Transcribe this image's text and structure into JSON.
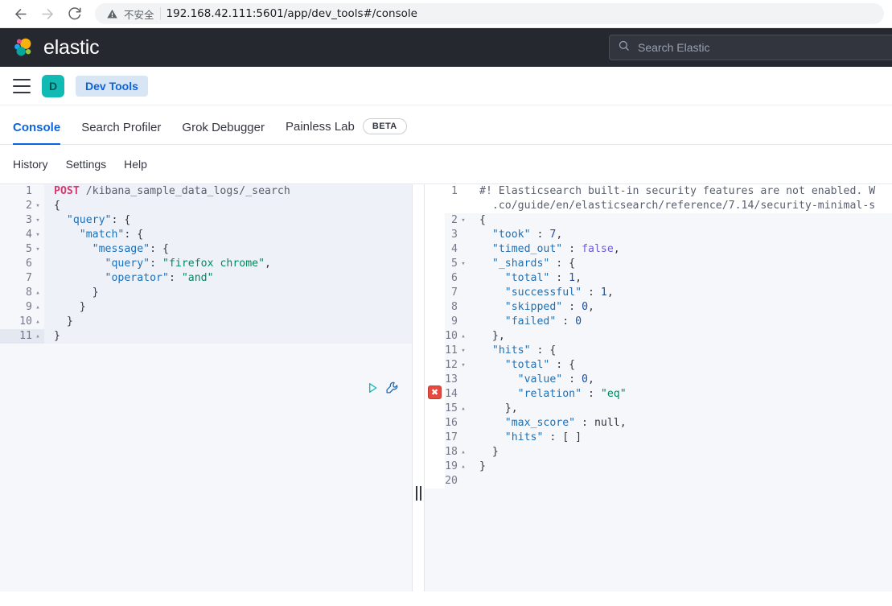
{
  "browser": {
    "back_icon": "back-arrow-icon",
    "forward_icon": "forward-arrow-icon",
    "reload_icon": "reload-icon",
    "warning_icon": "warning-triangle-icon",
    "insecure_label": "不安全",
    "url": "192.168.42.111:5601/app/dev_tools#/console"
  },
  "header": {
    "brand": "elastic",
    "logo_icon": "elastic-logo-icon",
    "search": {
      "icon": "search-icon",
      "placeholder": "Search Elastic",
      "value": ""
    }
  },
  "breadcrumb": {
    "menu_icon": "hamburger-menu-icon",
    "avatar_initial": "D",
    "app_name": "Dev Tools"
  },
  "tabs": [
    {
      "label": "Console",
      "active": true,
      "badge": ""
    },
    {
      "label": "Search Profiler",
      "active": false,
      "badge": ""
    },
    {
      "label": "Grok Debugger",
      "active": false,
      "badge": ""
    },
    {
      "label": "Painless Lab",
      "active": false,
      "badge": "BETA"
    }
  ],
  "submenu": [
    {
      "label": "History"
    },
    {
      "label": "Settings"
    },
    {
      "label": "Help"
    }
  ],
  "console": {
    "play_icon": "play-triangle-icon",
    "wrench_icon": "wrench-icon",
    "splitter_icon": "pane-resize-handle-icon",
    "error_icon": "error-x-icon",
    "request": {
      "lines": [
        {
          "n": "1",
          "fold": "",
          "active": false,
          "tokens": [
            {
              "c": "t-method",
              "t": "POST"
            },
            {
              "c": "t-path",
              "t": " /kibana_sample_data_logs/_search"
            }
          ]
        },
        {
          "n": "2",
          "fold": "▾",
          "active": false,
          "tokens": [
            {
              "c": "t-punct",
              "t": "{"
            }
          ]
        },
        {
          "n": "3",
          "fold": "▾",
          "active": false,
          "tokens": [
            {
              "c": "t-punct",
              "t": "  "
            },
            {
              "c": "t-key",
              "t": "\"query\""
            },
            {
              "c": "t-punct",
              "t": ": {"
            }
          ]
        },
        {
          "n": "4",
          "fold": "▾",
          "active": false,
          "tokens": [
            {
              "c": "t-punct",
              "t": "    "
            },
            {
              "c": "t-key",
              "t": "\"match\""
            },
            {
              "c": "t-punct",
              "t": ": {"
            }
          ]
        },
        {
          "n": "5",
          "fold": "▾",
          "active": false,
          "tokens": [
            {
              "c": "t-punct",
              "t": "      "
            },
            {
              "c": "t-key",
              "t": "\"message\""
            },
            {
              "c": "t-punct",
              "t": ": {"
            }
          ]
        },
        {
          "n": "6",
          "fold": "",
          "active": false,
          "tokens": [
            {
              "c": "t-punct",
              "t": "        "
            },
            {
              "c": "t-key",
              "t": "\"query\""
            },
            {
              "c": "t-punct",
              "t": ": "
            },
            {
              "c": "t-string",
              "t": "\"firefox chrome\""
            },
            {
              "c": "t-punct",
              "t": ","
            }
          ]
        },
        {
          "n": "7",
          "fold": "",
          "active": false,
          "tokens": [
            {
              "c": "t-punct",
              "t": "        "
            },
            {
              "c": "t-key",
              "t": "\"operator\""
            },
            {
              "c": "t-punct",
              "t": ": "
            },
            {
              "c": "t-string",
              "t": "\"and\""
            }
          ]
        },
        {
          "n": "8",
          "fold": "▴",
          "active": false,
          "tokens": [
            {
              "c": "t-punct",
              "t": "      }"
            }
          ]
        },
        {
          "n": "9",
          "fold": "▴",
          "active": false,
          "tokens": [
            {
              "c": "t-punct",
              "t": "    }"
            }
          ]
        },
        {
          "n": "10",
          "fold": "▴",
          "active": false,
          "tokens": [
            {
              "c": "t-punct",
              "t": "  }"
            }
          ]
        },
        {
          "n": "11",
          "fold": "▴",
          "active": true,
          "tokens": [
            {
              "c": "t-punct",
              "t": "}"
            }
          ]
        }
      ]
    },
    "response": {
      "lines": [
        {
          "n": "1",
          "fold": "",
          "active": true,
          "tokens": [
            {
              "c": "t-comment",
              "t": "#! Elasticsearch built-in security features are not enabled. W"
            }
          ]
        },
        {
          "n": "",
          "fold": "",
          "active": true,
          "tokens": [
            {
              "c": "t-comment",
              "t": "  .co/guide/en/elasticsearch/reference/7.14/security-minimal-s"
            }
          ]
        },
        {
          "n": "2",
          "fold": "▾",
          "active": false,
          "tokens": [
            {
              "c": "t-punct",
              "t": "{"
            }
          ]
        },
        {
          "n": "3",
          "fold": "",
          "active": false,
          "tokens": [
            {
              "c": "t-punct",
              "t": "  "
            },
            {
              "c": "t-key",
              "t": "\"took\""
            },
            {
              "c": "t-punct",
              "t": " : "
            },
            {
              "c": "t-number",
              "t": "7"
            },
            {
              "c": "t-punct",
              "t": ","
            }
          ]
        },
        {
          "n": "4",
          "fold": "",
          "active": false,
          "tokens": [
            {
              "c": "t-punct",
              "t": "  "
            },
            {
              "c": "t-key",
              "t": "\"timed_out\""
            },
            {
              "c": "t-punct",
              "t": " : "
            },
            {
              "c": "t-bool",
              "t": "false"
            },
            {
              "c": "t-punct",
              "t": ","
            }
          ]
        },
        {
          "n": "5",
          "fold": "▾",
          "active": false,
          "tokens": [
            {
              "c": "t-punct",
              "t": "  "
            },
            {
              "c": "t-key",
              "t": "\"_shards\""
            },
            {
              "c": "t-punct",
              "t": " : {"
            }
          ]
        },
        {
          "n": "6",
          "fold": "",
          "active": false,
          "tokens": [
            {
              "c": "t-punct",
              "t": "    "
            },
            {
              "c": "t-key",
              "t": "\"total\""
            },
            {
              "c": "t-punct",
              "t": " : "
            },
            {
              "c": "t-number",
              "t": "1"
            },
            {
              "c": "t-punct",
              "t": ","
            }
          ]
        },
        {
          "n": "7",
          "fold": "",
          "active": false,
          "tokens": [
            {
              "c": "t-punct",
              "t": "    "
            },
            {
              "c": "t-key",
              "t": "\"successful\""
            },
            {
              "c": "t-punct",
              "t": " : "
            },
            {
              "c": "t-number",
              "t": "1"
            },
            {
              "c": "t-punct",
              "t": ","
            }
          ]
        },
        {
          "n": "8",
          "fold": "",
          "active": false,
          "tokens": [
            {
              "c": "t-punct",
              "t": "    "
            },
            {
              "c": "t-key",
              "t": "\"skipped\""
            },
            {
              "c": "t-punct",
              "t": " : "
            },
            {
              "c": "t-number",
              "t": "0"
            },
            {
              "c": "t-punct",
              "t": ","
            }
          ]
        },
        {
          "n": "9",
          "fold": "",
          "active": false,
          "tokens": [
            {
              "c": "t-punct",
              "t": "    "
            },
            {
              "c": "t-key",
              "t": "\"failed\""
            },
            {
              "c": "t-punct",
              "t": " : "
            },
            {
              "c": "t-number",
              "t": "0"
            }
          ]
        },
        {
          "n": "10",
          "fold": "▴",
          "active": false,
          "tokens": [
            {
              "c": "t-punct",
              "t": "  },"
            }
          ]
        },
        {
          "n": "11",
          "fold": "▾",
          "active": false,
          "tokens": [
            {
              "c": "t-punct",
              "t": "  "
            },
            {
              "c": "t-key",
              "t": "\"hits\""
            },
            {
              "c": "t-punct",
              "t": " : {"
            }
          ]
        },
        {
          "n": "12",
          "fold": "▾",
          "active": false,
          "tokens": [
            {
              "c": "t-punct",
              "t": "    "
            },
            {
              "c": "t-key",
              "t": "\"total\""
            },
            {
              "c": "t-punct",
              "t": " : {"
            }
          ]
        },
        {
          "n": "13",
          "fold": "",
          "active": false,
          "tokens": [
            {
              "c": "t-punct",
              "t": "      "
            },
            {
              "c": "t-key",
              "t": "\"value\""
            },
            {
              "c": "t-punct",
              "t": " : "
            },
            {
              "c": "t-number",
              "t": "0"
            },
            {
              "c": "t-punct",
              "t": ","
            }
          ]
        },
        {
          "n": "14",
          "fold": "",
          "active": false,
          "tokens": [
            {
              "c": "t-punct",
              "t": "      "
            },
            {
              "c": "t-key",
              "t": "\"relation\""
            },
            {
              "c": "t-punct",
              "t": " : "
            },
            {
              "c": "t-string",
              "t": "\"eq\""
            }
          ]
        },
        {
          "n": "15",
          "fold": "▴",
          "active": false,
          "tokens": [
            {
              "c": "t-punct",
              "t": "    },"
            }
          ]
        },
        {
          "n": "16",
          "fold": "",
          "active": false,
          "tokens": [
            {
              "c": "t-punct",
              "t": "    "
            },
            {
              "c": "t-key",
              "t": "\"max_score\""
            },
            {
              "c": "t-punct",
              "t": " : "
            },
            {
              "c": "t-null",
              "t": "null"
            },
            {
              "c": "t-punct",
              "t": ","
            }
          ]
        },
        {
          "n": "17",
          "fold": "",
          "active": false,
          "tokens": [
            {
              "c": "t-punct",
              "t": "    "
            },
            {
              "c": "t-key",
              "t": "\"hits\""
            },
            {
              "c": "t-punct",
              "t": " : [ ]"
            }
          ]
        },
        {
          "n": "18",
          "fold": "▴",
          "active": false,
          "tokens": [
            {
              "c": "t-punct",
              "t": "  }"
            }
          ]
        },
        {
          "n": "19",
          "fold": "▴",
          "active": false,
          "tokens": [
            {
              "c": "t-punct",
              "t": "}"
            }
          ]
        },
        {
          "n": "20",
          "fold": "",
          "active": false,
          "tokens": []
        }
      ]
    }
  },
  "colors": {
    "accent_blue": "#0b64dd",
    "header_dark": "#25282f",
    "avatar_teal": "#12bab4",
    "error_red": "#e7493e",
    "play_teal": "#12bab4"
  }
}
